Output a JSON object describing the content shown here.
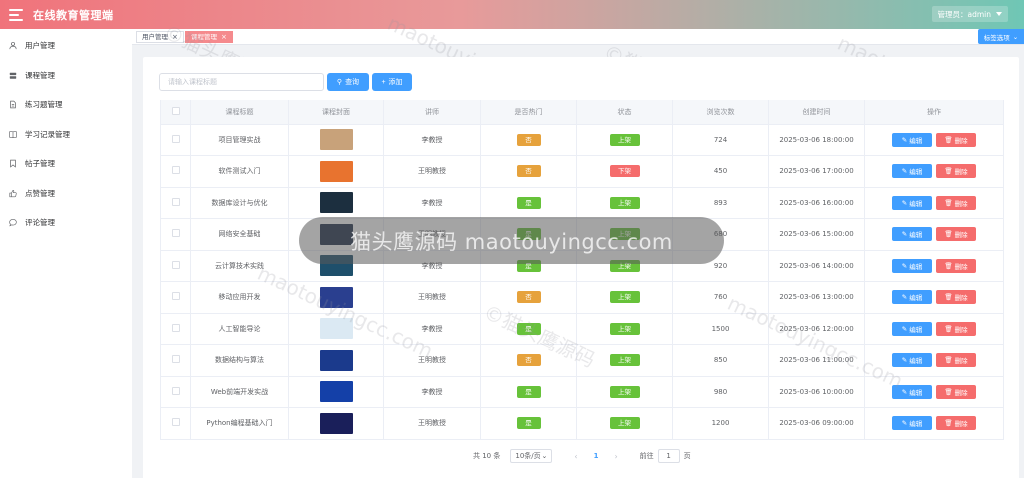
{
  "header": {
    "title": "在线教育管理端",
    "user_label": "管理员：admin"
  },
  "sidebar": {
    "items": [
      {
        "label": "用户管理",
        "icon": "user-icon"
      },
      {
        "label": "课程管理",
        "icon": "stack-icon"
      },
      {
        "label": "练习题管理",
        "icon": "document-icon"
      },
      {
        "label": "学习记录管理",
        "icon": "book-icon"
      },
      {
        "label": "帖子管理",
        "icon": "bookmark-icon"
      },
      {
        "label": "点赞管理",
        "icon": "thumb-icon"
      },
      {
        "label": "评论管理",
        "icon": "comment-icon"
      }
    ]
  },
  "tags": {
    "items": [
      {
        "label": "用户管理",
        "active": false
      },
      {
        "label": "课程管理",
        "active": true
      }
    ],
    "options_label": "标签选项"
  },
  "toolbar": {
    "search_placeholder": "请输入课程标题",
    "search_label": "查询",
    "add_label": "添加"
  },
  "table": {
    "columns": [
      "课程标题",
      "课程封面",
      "讲师",
      "是否热门",
      "状态",
      "浏览次数",
      "创建时间",
      "操作"
    ],
    "edit_label": "编辑",
    "delete_label": "删除",
    "rows": [
      {
        "title": "项目管理实战",
        "teacher": "李教授",
        "hot": "否",
        "status": "上架",
        "views": "724",
        "created": "2025-03-06 18:00:00",
        "cover_color": "#c8a27a"
      },
      {
        "title": "软件测试入门",
        "teacher": "王明教授",
        "hot": "否",
        "status": "下架",
        "views": "450",
        "created": "2025-03-06 17:00:00",
        "cover_color": "#e8732f"
      },
      {
        "title": "数据库设计与优化",
        "teacher": "李教授",
        "hot": "是",
        "status": "上架",
        "views": "893",
        "created": "2025-03-06 16:00:00",
        "cover_color": "#1c2f3f"
      },
      {
        "title": "网络安全基础",
        "teacher": "王明教授",
        "hot": "是",
        "status": "上架",
        "views": "680",
        "created": "2025-03-06 15:00:00",
        "cover_color": "#20304a"
      },
      {
        "title": "云计算技术实践",
        "teacher": "李教授",
        "hot": "是",
        "status": "上架",
        "views": "920",
        "created": "2025-03-06 14:00:00",
        "cover_color": "#1e4f6b"
      },
      {
        "title": "移动应用开发",
        "teacher": "王明教授",
        "hot": "否",
        "status": "上架",
        "views": "760",
        "created": "2025-03-06 13:00:00",
        "cover_color": "#2a3f8f"
      },
      {
        "title": "人工智能导论",
        "teacher": "李教授",
        "hot": "是",
        "status": "上架",
        "views": "1500",
        "created": "2025-03-06 12:00:00",
        "cover_color": "#dbe9f3"
      },
      {
        "title": "数据结构与算法",
        "teacher": "王明教授",
        "hot": "否",
        "status": "上架",
        "views": "850",
        "created": "2025-03-06 11:00:00",
        "cover_color": "#1b3a8c"
      },
      {
        "title": "Web前端开发实战",
        "teacher": "李教授",
        "hot": "是",
        "status": "上架",
        "views": "980",
        "created": "2025-03-06 10:00:00",
        "cover_color": "#1440a8"
      },
      {
        "title": "Python编程基础入门",
        "teacher": "王明教授",
        "hot": "是",
        "status": "上架",
        "views": "1200",
        "created": "2025-03-06 09:00:00",
        "cover_color": "#1a1f5a"
      }
    ]
  },
  "pagination": {
    "total": "共 10 条",
    "page_size": "10条/页",
    "current": "1",
    "goto_label": "前往",
    "goto_value": "1",
    "page_suffix": "页"
  },
  "watermark": {
    "site": "maotouyingcc.com",
    "cn": "©猫头鹰源码",
    "overlay": "猫头鹰源码 maotouyingcc.com"
  }
}
